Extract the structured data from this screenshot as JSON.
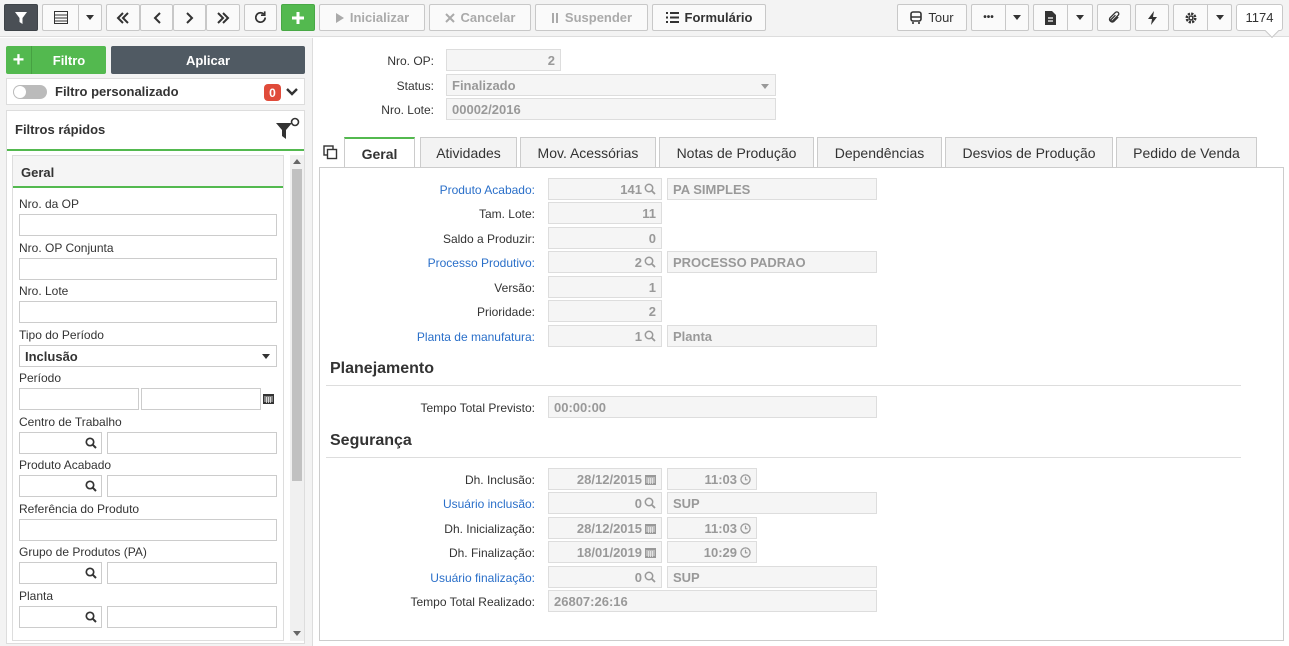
{
  "toolbar": {
    "inicializar": "Inicializar",
    "cancelar": "Cancelar",
    "suspender": "Suspender",
    "formulario": "Formulário",
    "tour": "Tour",
    "more": "•••",
    "count": "1174"
  },
  "filter_panel": {
    "filtro_label": "Filtro",
    "aplicar_label": "Aplicar",
    "custom_filter_label": "Filtro personalizado",
    "custom_filter_count": "0",
    "quick_filters_title": "Filtros rápidos",
    "section_title": "Geral",
    "fields": {
      "nro_op": "Nro. da OP",
      "nro_op_conjunta": "Nro. OP Conjunta",
      "nro_lote": "Nro. Lote",
      "tipo_periodo": "Tipo do Período",
      "tipo_periodo_value": "Inclusão",
      "periodo": "Período",
      "centro_trabalho": "Centro de Trabalho",
      "produto_acabado": "Produto Acabado",
      "referencia_produto": "Referência do Produto",
      "grupo_produtos": "Grupo de Produtos (PA)",
      "planta": "Planta"
    }
  },
  "header": {
    "nro_op_label": "Nro. OP:",
    "nro_op_value": "2",
    "status_label": "Status:",
    "status_value": "Finalizado",
    "nro_lote_label": "Nro. Lote:",
    "nro_lote_value": "00002/2016"
  },
  "tabs": [
    "Geral",
    "Atividades",
    "Mov. Acessórias",
    "Notas de Produção",
    "Dependências",
    "Desvios de Produção",
    "Pedido de Venda"
  ],
  "form": {
    "produto_acabado_label": "Produto Acabado:",
    "produto_acabado_code": "141",
    "produto_acabado_desc": "PA SIMPLES",
    "tam_lote_label": "Tam. Lote:",
    "tam_lote_value": "11",
    "saldo_label": "Saldo a Produzir:",
    "saldo_value": "0",
    "processo_label": "Processo Produtivo:",
    "processo_code": "2",
    "processo_desc": "PROCESSO PADRAO",
    "versao_label": "Versão:",
    "versao_value": "1",
    "prioridade_label": "Prioridade:",
    "prioridade_value": "2",
    "planta_label": "Planta de manufatura:",
    "planta_code": "1",
    "planta_desc": "Planta",
    "planejamento_title": "Planejamento",
    "tempo_previsto_label": "Tempo Total Previsto:",
    "tempo_previsto_value": "00:00:00",
    "seguranca_title": "Segurança",
    "dh_inclusao_label": "Dh. Inclusão:",
    "dh_inclusao_date": "28/12/2015",
    "dh_inclusao_time": "11:03",
    "usuario_inclusao_label": "Usuário inclusão:",
    "usuario_inclusao_code": "0",
    "usuario_inclusao_name": "SUP",
    "dh_inicializacao_label": "Dh. Inicialização:",
    "dh_inicializacao_date": "28/12/2015",
    "dh_inicializacao_time": "11:03",
    "dh_finalizacao_label": "Dh. Finalização:",
    "dh_finalizacao_date": "18/01/2019",
    "dh_finalizacao_time": "10:29",
    "usuario_finalizacao_label": "Usuário finalização:",
    "usuario_finalizacao_code": "0",
    "usuario_finalizacao_name": "SUP",
    "tempo_realizado_label": "Tempo Total Realizado:",
    "tempo_realizado_value": "26807:26:16"
  }
}
